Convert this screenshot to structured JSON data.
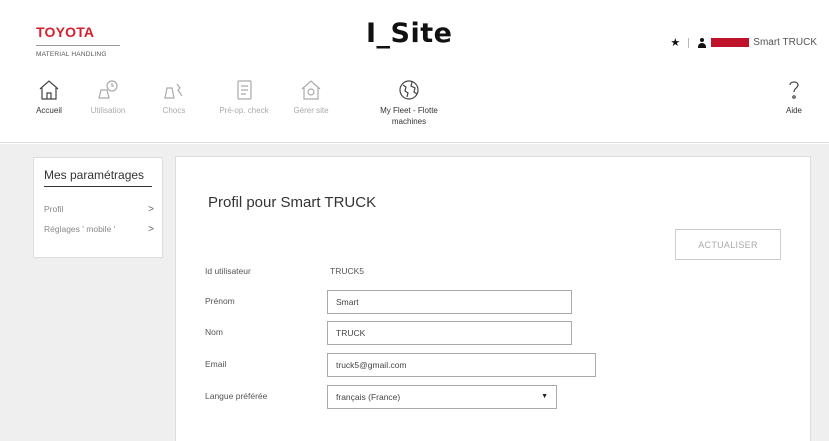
{
  "brand": {
    "logo_main": "TOYOTA",
    "logo_sub": "MATERIAL HANDLING",
    "app_title": "I_Site",
    "color_red": "#d81e2c"
  },
  "user": {
    "name": "Smart TRUCK",
    "favorite_icon": "star-icon",
    "user_icon": "person-icon"
  },
  "nav": {
    "items": [
      {
        "label": "Accueil",
        "icon": "home-icon",
        "enabled": true
      },
      {
        "label": "Utilisation",
        "icon": "utilisation-icon",
        "enabled": false
      },
      {
        "label": "Chocs",
        "icon": "shocks-icon",
        "enabled": false
      },
      {
        "label": "Pré-op. check",
        "icon": "checklist-icon",
        "enabled": false
      },
      {
        "label": "Gérer site",
        "icon": "manage-site-icon",
        "enabled": false
      },
      {
        "label": "My Fleet - Flotte machines",
        "label_line1": "My Fleet - Flotte",
        "label_line2": "machines",
        "icon": "globe-icon",
        "enabled": true
      },
      {
        "label": "Aide",
        "icon": "help-icon",
        "enabled": true
      }
    ]
  },
  "sidebar": {
    "title": "Mes paramétrages",
    "items": [
      {
        "label": "Profil"
      },
      {
        "label": "Réglages ' mobile '"
      }
    ]
  },
  "profile": {
    "title": "Profil pour Smart TRUCK",
    "update_button": "ACTUALISER",
    "fields": {
      "user_id_label": "Id utilisateur",
      "user_id_value": "TRUCK5",
      "firstname_label": "Prénom",
      "firstname_value": "Smart",
      "lastname_label": "Nom",
      "lastname_value": "TRUCK",
      "email_label": "Email",
      "email_value": "truck5@gmail.com",
      "language_label": "Langue préférée",
      "language_value": "français (France)"
    }
  }
}
